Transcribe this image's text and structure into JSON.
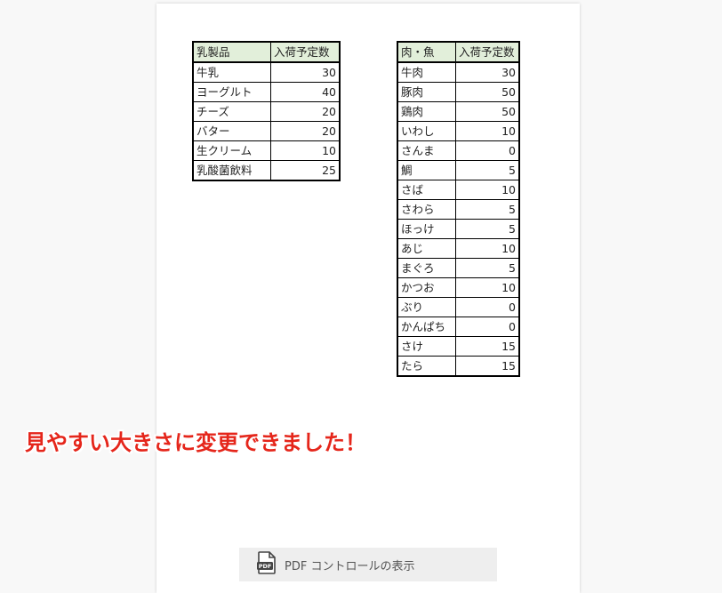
{
  "dairy_table": {
    "headers": [
      "乳製品",
      "入荷予定数"
    ],
    "rows": [
      [
        "牛乳",
        "30"
      ],
      [
        "ヨーグルト",
        "40"
      ],
      [
        "チーズ",
        "20"
      ],
      [
        "バター",
        "20"
      ],
      [
        "生クリーム",
        "10"
      ],
      [
        "乳酸菌飲料",
        "25"
      ]
    ]
  },
  "meat_table": {
    "headers": [
      "肉・魚",
      "入荷予定数"
    ],
    "rows": [
      [
        "牛肉",
        "30"
      ],
      [
        "豚肉",
        "50"
      ],
      [
        "鶏肉",
        "50"
      ],
      [
        "いわし",
        "10"
      ],
      [
        "さんま",
        "0"
      ],
      [
        "鯛",
        "5"
      ],
      [
        "さば",
        "10"
      ],
      [
        "さわら",
        "5"
      ],
      [
        "ほっけ",
        "5"
      ],
      [
        "あじ",
        "10"
      ],
      [
        "まぐろ",
        "5"
      ],
      [
        "かつお",
        "10"
      ],
      [
        "ぶり",
        "0"
      ],
      [
        "かんぱち",
        "0"
      ],
      [
        "さけ",
        "15"
      ],
      [
        "たら",
        "15"
      ]
    ]
  },
  "caption": "見やすい大きさに変更できました！",
  "pdf_controls": {
    "label": "PDF コントロールの表示",
    "icon": "pdf-document-icon"
  },
  "colors": {
    "header_fill": "#e2efda",
    "caption_red": "#e5261b"
  }
}
